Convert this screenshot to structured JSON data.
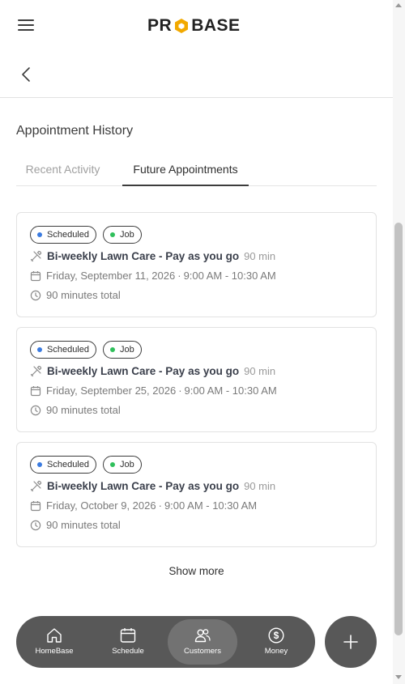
{
  "header": {
    "logo_left": "PR",
    "logo_right": "BASE"
  },
  "page": {
    "title": "Appointment History"
  },
  "tabs": [
    {
      "label": "Recent Activity",
      "active": false
    },
    {
      "label": "Future Appointments",
      "active": true
    }
  ],
  "appointments": [
    {
      "status": "Scheduled",
      "type": "Job",
      "service": "Bi-weekly Lawn Care - Pay as you go",
      "duration": "90 min",
      "date": "Friday, September 11, 2026",
      "time": "9:00 AM - 10:30 AM",
      "total": "90 minutes total"
    },
    {
      "status": "Scheduled",
      "type": "Job",
      "service": "Bi-weekly Lawn Care - Pay as you go",
      "duration": "90 min",
      "date": "Friday, September 25, 2026",
      "time": "9:00 AM - 10:30 AM",
      "total": "90 minutes total"
    },
    {
      "status": "Scheduled",
      "type": "Job",
      "service": "Bi-weekly Lawn Care - Pay as you go",
      "duration": "90 min",
      "date": "Friday, October 9, 2026",
      "time": "9:00 AM - 10:30 AM",
      "total": "90 minutes total"
    }
  ],
  "show_more_label": "Show more",
  "bottom_nav": [
    {
      "label": "HomeBase",
      "icon": "home-icon",
      "active": false
    },
    {
      "label": "Schedule",
      "icon": "calendar-icon",
      "active": false
    },
    {
      "label": "Customers",
      "icon": "users-icon",
      "active": true
    },
    {
      "label": "Money",
      "icon": "dollar-icon",
      "active": false
    }
  ],
  "colors": {
    "scheduled_dot": "#3b7be0",
    "job_dot": "#2fbf5b",
    "logo_accent": "#f2a900",
    "nav_bg": "#585858",
    "nav_active": "#727272"
  }
}
